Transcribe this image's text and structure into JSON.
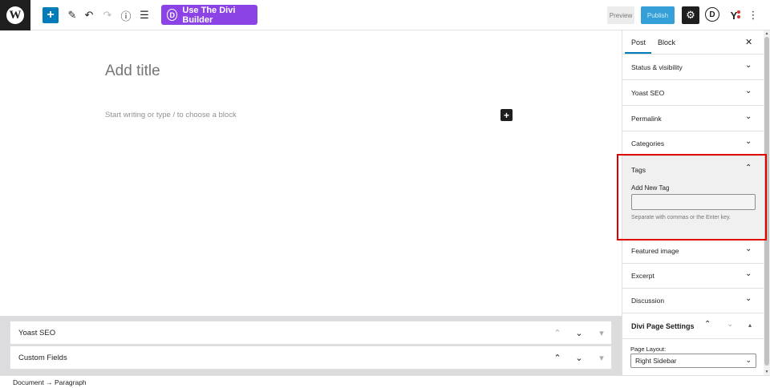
{
  "toolbar": {
    "logo_letter": "W",
    "add_icon": "+",
    "edit_icon": "✎",
    "undo_icon": "↶",
    "redo_icon": "↷",
    "info_icon": "ⓘ",
    "outline_icon": "☰",
    "divi_button_icon": "D",
    "divi_button_label": "Use The Divi Builder",
    "preview_label": "Preview",
    "publish_label": "Publish",
    "settings_icon": "⚙",
    "divi_circle_icon": "D",
    "yoast_icon": "Y",
    "more_icon": "⋮",
    "accent_color": "#007cba",
    "divi_color": "#8c43e6"
  },
  "editor": {
    "title_placeholder": "Add title",
    "paragraph_placeholder": "Start writing or type / to choose a block",
    "inserter_icon": "+"
  },
  "metaboxes": [
    {
      "title": "Yoast SEO",
      "up": "⌃",
      "down": "⌄",
      "toggle": "▾"
    },
    {
      "title": "Custom Fields",
      "up": "⌃",
      "down": "⌄",
      "toggle": "▾"
    }
  ],
  "footer": {
    "breadcrumb": "Document → Paragraph"
  },
  "sidebar": {
    "tabs": [
      {
        "label": "Post"
      },
      {
        "label": "Block"
      }
    ],
    "close_icon": "✕",
    "panels": [
      {
        "title": "Status & visibility",
        "chevron": "⌄"
      },
      {
        "title": "Yoast SEO",
        "chevron": "⌄"
      },
      {
        "title": "Permalink",
        "chevron": "⌄"
      },
      {
        "title": "Categories",
        "chevron": "⌄"
      }
    ],
    "tags": {
      "title": "Tags",
      "chevron": "⌃",
      "label": "Add New Tag",
      "value": "",
      "help": "Separate with commas or the Enter key."
    },
    "panels_after": [
      {
        "title": "Featured image",
        "chevron": "⌄"
      },
      {
        "title": "Excerpt",
        "chevron": "⌄"
      },
      {
        "title": "Discussion",
        "chevron": "⌄"
      }
    ],
    "divi": {
      "title": "Divi Page Settings",
      "up": "⌃",
      "down": "⌄",
      "toggle": "▴",
      "layout_label": "Page Layout:",
      "layout_value": "Right Sidebar",
      "layout_arrow": "⌄"
    }
  },
  "highlight_color": "#e00000"
}
